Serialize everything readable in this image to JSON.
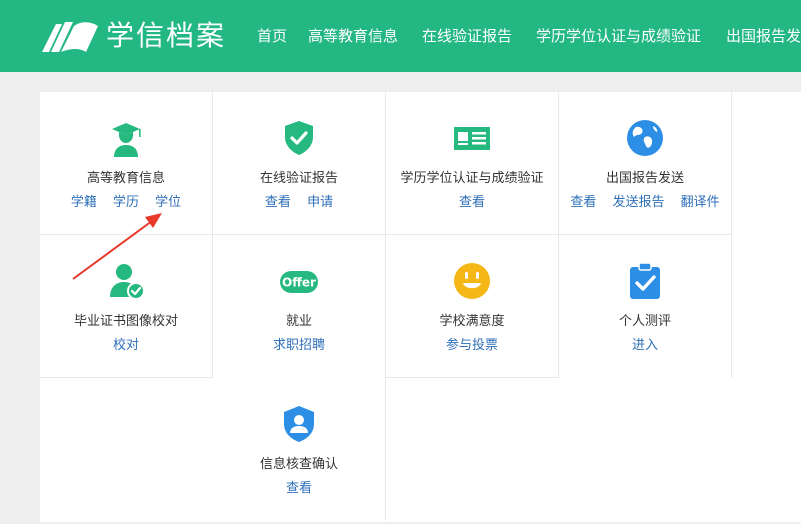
{
  "header": {
    "brand": "学信档案",
    "nav": [
      "首页",
      "高等教育信息",
      "在线验证报告",
      "学历学位认证与成绩验证",
      "出国报告发"
    ]
  },
  "colors": {
    "header_bg": "#22b783",
    "icon_green": "#25b97f",
    "icon_blue": "#2d8ee6",
    "icon_yellow": "#f5b716",
    "link": "#2f6fb8",
    "annotation_arrow": "#e8392b"
  },
  "services": [
    {
      "icon": "graduation-cap-person-icon",
      "title": "高等教育信息",
      "links": [
        "学籍",
        "学历",
        "学位"
      ]
    },
    {
      "icon": "shield-check-icon",
      "title": "在线验证报告",
      "links": [
        "查看",
        "申请"
      ]
    },
    {
      "icon": "id-card-icon",
      "title": "学历学位认证与成绩验证",
      "links": [
        "查看"
      ]
    },
    {
      "icon": "globe-icon",
      "title": "出国报告发送",
      "links": [
        "查看",
        "发送报告",
        "翻译件"
      ]
    },
    {
      "icon": "person-verified-icon",
      "title": "毕业证书图像校对",
      "links": [
        "校对"
      ]
    },
    {
      "icon": "offer-badge-icon",
      "title": "就业",
      "links": [
        "求职招聘"
      ],
      "icon_text": "Offer"
    },
    {
      "icon": "smiley-face-icon",
      "title": "学校满意度",
      "links": [
        "参与投票"
      ]
    },
    {
      "icon": "clipboard-check-icon",
      "title": "个人测评",
      "links": [
        "进入"
      ]
    },
    {
      "icon": "shield-person-icon",
      "title": "信息核查确认",
      "links": [
        "查看"
      ]
    }
  ]
}
